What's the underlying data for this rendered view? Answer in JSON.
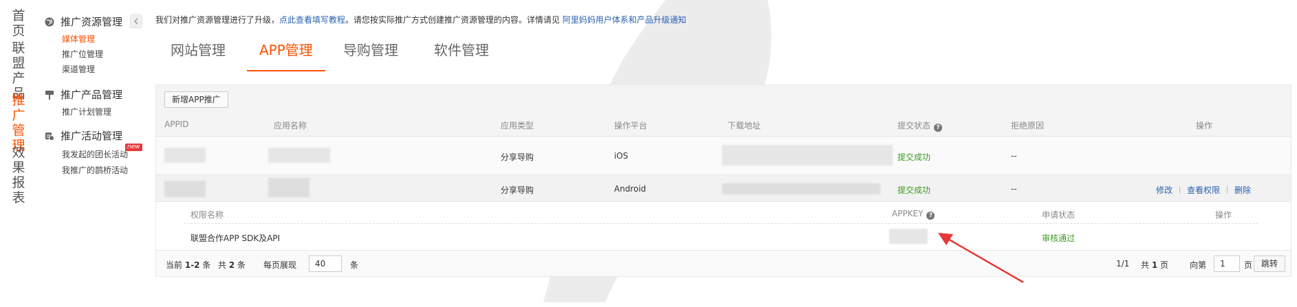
{
  "left_nav": [
    {
      "label": "首页",
      "active": false
    },
    {
      "label": "联盟产品",
      "active": false
    },
    {
      "label": "推广管理",
      "active": true
    },
    {
      "label": "效果报表",
      "active": false
    }
  ],
  "sidebar": {
    "groups": [
      {
        "title": "推广资源管理",
        "icon": "globe-icon",
        "items": [
          "媒体管理",
          "推广位管理",
          "渠道管理"
        ]
      },
      {
        "title": "推广产品管理",
        "icon": "flag-icon",
        "items": [
          "推广计划管理"
        ]
      },
      {
        "title": "推广活动管理",
        "icon": "activity-icon",
        "items": [
          "我发起的团长活动",
          "我推广的鹊桥活动"
        ]
      }
    ],
    "active_item": "媒体管理",
    "new_badge": "new"
  },
  "notice": {
    "text1": "我们对推广资源管理进行了升级，",
    "link1": "点此查看填写教程",
    "text2": "。请您按实际推广方式创建推广资源管理的内容。详情请见 ",
    "link2": "阿里妈妈用户体系和产品升级通知"
  },
  "tabs": [
    {
      "label": "网站管理",
      "active": false
    },
    {
      "label": "APP管理",
      "active": true
    },
    {
      "label": "导购管理",
      "active": false
    },
    {
      "label": "软件管理",
      "active": false
    }
  ],
  "toolbar": {
    "add_label": "新增APP推广"
  },
  "table": {
    "headers": [
      "APPID",
      "应用名称",
      "应用类型",
      "操作平台",
      "下载地址",
      "提交状态",
      "拒绝原因",
      "操作"
    ],
    "rows": [
      {
        "type": "分享导购",
        "platform": "iOS",
        "status": "提交成功",
        "reason": "--",
        "actions": []
      },
      {
        "type": "分享导购",
        "platform": "Android",
        "status": "提交成功",
        "reason": "--",
        "actions": [
          "修改",
          "查看权限",
          "删除"
        ]
      }
    ]
  },
  "permissions": {
    "headers": [
      "权限名称",
      "APPKEY",
      "申请状态",
      "操作"
    ],
    "rows": [
      {
        "name": "联盟合作APP SDK及API",
        "status": "审核通过"
      }
    ]
  },
  "footer": {
    "current_label": "当前",
    "range": "1-2",
    "unit1": "条",
    "total_label": "共",
    "total": "2",
    "unit2": "条",
    "per_page_label": "每页展现",
    "per_page": "40",
    "unit3": "条",
    "page_pos": "1/1",
    "total_pages_label": "共",
    "total_pages": "1",
    "pages_unit": "页",
    "goto_label": "向第",
    "goto_value": "1",
    "goto_unit": "页",
    "jump_label": "跳转"
  },
  "colors": {
    "accent": "#ff5000",
    "link": "#2a61b0",
    "success": "#3c9a22"
  }
}
